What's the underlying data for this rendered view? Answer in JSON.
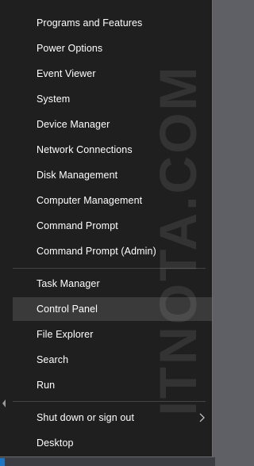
{
  "menu": {
    "groups": [
      {
        "items": [
          {
            "label": "Programs and Features"
          },
          {
            "label": "Power Options"
          },
          {
            "label": "Event Viewer"
          },
          {
            "label": "System"
          },
          {
            "label": "Device Manager"
          },
          {
            "label": "Network Connections"
          },
          {
            "label": "Disk Management"
          },
          {
            "label": "Computer Management"
          },
          {
            "label": "Command Prompt"
          },
          {
            "label": "Command Prompt (Admin)"
          }
        ]
      },
      {
        "items": [
          {
            "label": "Task Manager"
          },
          {
            "label": "Control Panel",
            "highlighted": true
          },
          {
            "label": "File Explorer"
          },
          {
            "label": "Search"
          },
          {
            "label": "Run"
          }
        ]
      },
      {
        "items": [
          {
            "label": "Shut down or sign out",
            "submenu": true,
            "icon": "chevron-right-icon"
          },
          {
            "label": "Desktop"
          }
        ]
      }
    ]
  },
  "watermark": {
    "text": "ITNOTA.COM"
  },
  "colors": {
    "menu_background": "#1f1f1f",
    "highlight": "#3a3a3a",
    "separator": "#454545",
    "text": "#ffffff"
  }
}
